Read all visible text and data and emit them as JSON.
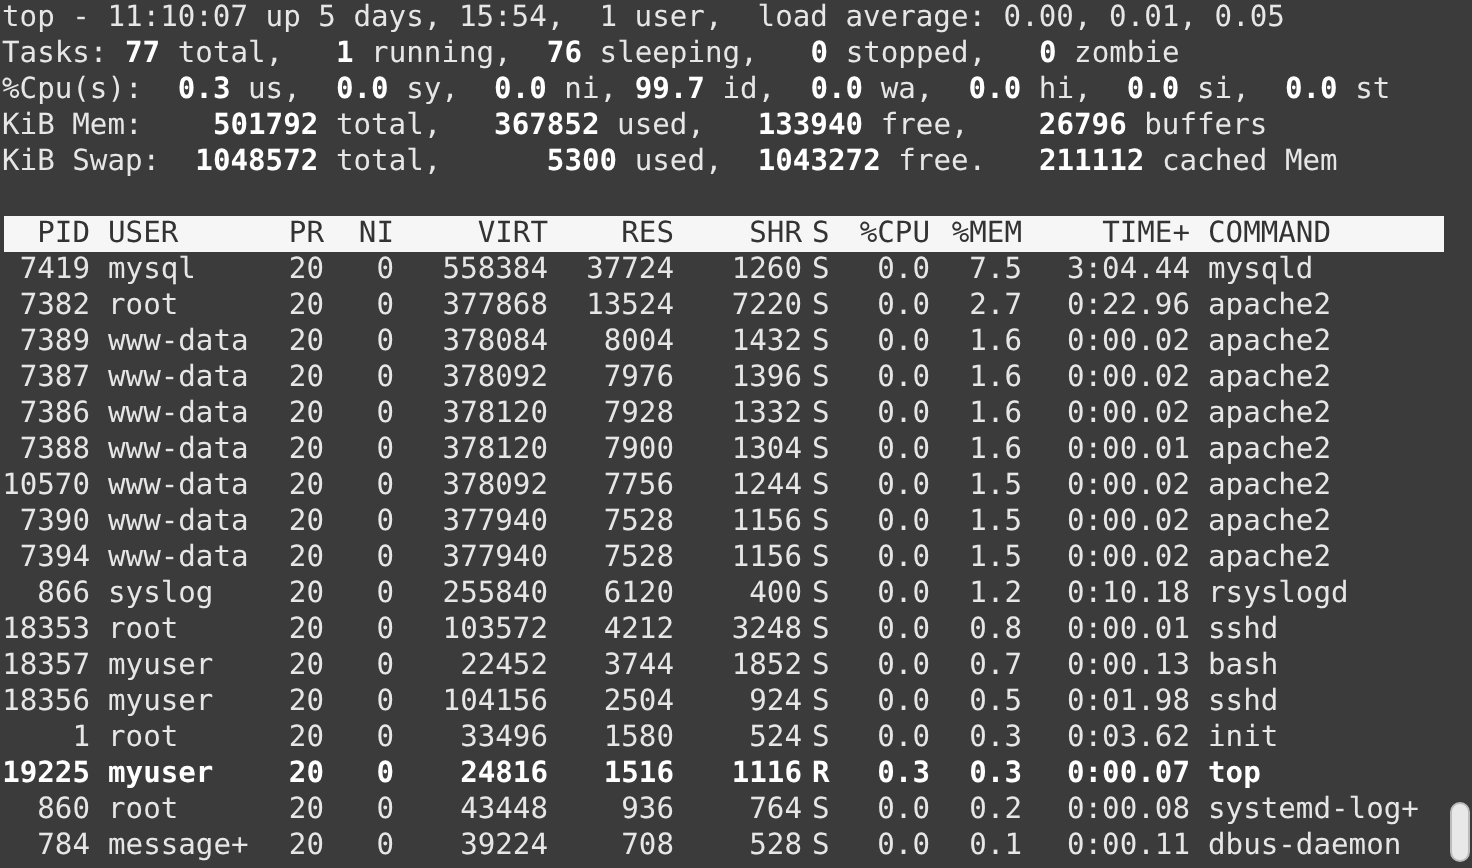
{
  "summary_lines": [
    "top - 11:10:07 up 5 days, 15:54,  1 user,  load average: 0.00, 0.01, 0.05",
    "Tasks: **77** total,   **1** running,  **76** sleeping,   **0** stopped,   **0** zombie",
    "%Cpu(s):  **0.3** us,  **0.0** sy,  **0.0** ni, **99.7** id,  **0.0** wa,  **0.0** hi,  **0.0** si,  **0.0** st",
    "KiB Mem:    **501792** total,   **367852** used,   **133940** free,    **26796** buffers",
    "KiB Swap:  **1048572** total,      **5300** used,  **1043272** free.   **211112** cached Mem"
  ],
  "table": {
    "columns": [
      "PID",
      "USER",
      "PR",
      "NI",
      "VIRT",
      "RES",
      "SHR",
      "S",
      "%CPU",
      "%MEM",
      "TIME+",
      "COMMAND"
    ],
    "rows": [
      {
        "cells": [
          "7419",
          "mysql",
          "20",
          "0",
          "558384",
          "37724",
          "1260",
          "S",
          "0.0",
          "7.5",
          "3:04.44",
          "mysqld"
        ],
        "highlighted": false
      },
      {
        "cells": [
          "7382",
          "root",
          "20",
          "0",
          "377868",
          "13524",
          "7220",
          "S",
          "0.0",
          "2.7",
          "0:22.96",
          "apache2"
        ],
        "highlighted": false
      },
      {
        "cells": [
          "7389",
          "www-data",
          "20",
          "0",
          "378084",
          "8004",
          "1432",
          "S",
          "0.0",
          "1.6",
          "0:00.02",
          "apache2"
        ],
        "highlighted": false
      },
      {
        "cells": [
          "7387",
          "www-data",
          "20",
          "0",
          "378092",
          "7976",
          "1396",
          "S",
          "0.0",
          "1.6",
          "0:00.02",
          "apache2"
        ],
        "highlighted": false
      },
      {
        "cells": [
          "7386",
          "www-data",
          "20",
          "0",
          "378120",
          "7928",
          "1332",
          "S",
          "0.0",
          "1.6",
          "0:00.02",
          "apache2"
        ],
        "highlighted": false
      },
      {
        "cells": [
          "7388",
          "www-data",
          "20",
          "0",
          "378120",
          "7900",
          "1304",
          "S",
          "0.0",
          "1.6",
          "0:00.01",
          "apache2"
        ],
        "highlighted": false
      },
      {
        "cells": [
          "10570",
          "www-data",
          "20",
          "0",
          "378092",
          "7756",
          "1244",
          "S",
          "0.0",
          "1.5",
          "0:00.02",
          "apache2"
        ],
        "highlighted": false
      },
      {
        "cells": [
          "7390",
          "www-data",
          "20",
          "0",
          "377940",
          "7528",
          "1156",
          "S",
          "0.0",
          "1.5",
          "0:00.02",
          "apache2"
        ],
        "highlighted": false
      },
      {
        "cells": [
          "7394",
          "www-data",
          "20",
          "0",
          "377940",
          "7528",
          "1156",
          "S",
          "0.0",
          "1.5",
          "0:00.02",
          "apache2"
        ],
        "highlighted": false
      },
      {
        "cells": [
          "866",
          "syslog",
          "20",
          "0",
          "255840",
          "6120",
          "400",
          "S",
          "0.0",
          "1.2",
          "0:10.18",
          "rsyslogd"
        ],
        "highlighted": false
      },
      {
        "cells": [
          "18353",
          "root",
          "20",
          "0",
          "103572",
          "4212",
          "3248",
          "S",
          "0.0",
          "0.8",
          "0:00.01",
          "sshd"
        ],
        "highlighted": false
      },
      {
        "cells": [
          "18357",
          "myuser",
          "20",
          "0",
          "22452",
          "3744",
          "1852",
          "S",
          "0.0",
          "0.7",
          "0:00.13",
          "bash"
        ],
        "highlighted": false
      },
      {
        "cells": [
          "18356",
          "myuser",
          "20",
          "0",
          "104156",
          "2504",
          "924",
          "S",
          "0.0",
          "0.5",
          "0:01.98",
          "sshd"
        ],
        "highlighted": false
      },
      {
        "cells": [
          "1",
          "root",
          "20",
          "0",
          "33496",
          "1580",
          "524",
          "S",
          "0.0",
          "0.3",
          "0:03.62",
          "init"
        ],
        "highlighted": false
      },
      {
        "cells": [
          "19225",
          "myuser",
          "20",
          "0",
          "24816",
          "1516",
          "1116",
          "R",
          "0.3",
          "0.3",
          "0:00.07",
          "top"
        ],
        "highlighted": true
      },
      {
        "cells": [
          "860",
          "root",
          "20",
          "0",
          "43448",
          "936",
          "764",
          "S",
          "0.0",
          "0.2",
          "0:00.08",
          "systemd-log+"
        ],
        "highlighted": false
      },
      {
        "cells": [
          "784",
          "message+",
          "20",
          "0",
          "39224",
          "708",
          "528",
          "S",
          "0.0",
          "0.1",
          "0:00.11",
          "dbus-daemon"
        ],
        "highlighted": false
      }
    ]
  }
}
